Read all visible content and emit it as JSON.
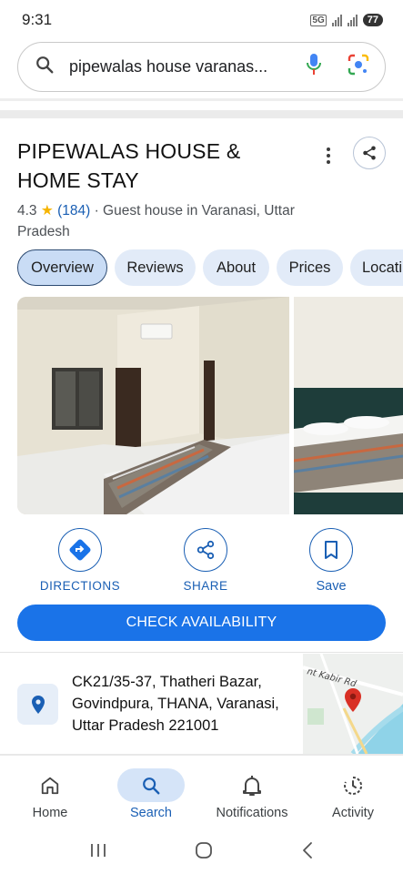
{
  "status_bar": {
    "time": "9:31",
    "network": "5G",
    "battery": "77"
  },
  "search": {
    "query": "pipewalas house varanas..."
  },
  "place": {
    "title": "PIPEWALAS HOUSE & HOME STAY",
    "rating": "4.3",
    "review_count": "(184)",
    "category": "· Guest house in Varanasi, Uttar Pradesh"
  },
  "tabs": [
    {
      "label": "Overview",
      "active": true
    },
    {
      "label": "Reviews",
      "active": false
    },
    {
      "label": "About",
      "active": false
    },
    {
      "label": "Prices",
      "active": false
    },
    {
      "label": "Locati",
      "active": false
    }
  ],
  "actions": {
    "directions": "DIRECTIONS",
    "share": "SHARE",
    "save": "Save"
  },
  "cta": {
    "label": "CHECK AVAILABILITY"
  },
  "address": {
    "text": "CK21/35-37, Thatheri Bazar, Govindpura, THANA, Varanasi, Uttar Pradesh 221001",
    "map_label": "nt Kabir Rd"
  },
  "bottom_nav": {
    "home": "Home",
    "search": "Search",
    "notifications": "Notifications",
    "activity": "Activity"
  },
  "colors": {
    "accent": "#1a73e8",
    "link": "#1a5fb4",
    "tab_bg": "#e2ebf8",
    "star": "#f6b400",
    "pin": "#d93025"
  }
}
